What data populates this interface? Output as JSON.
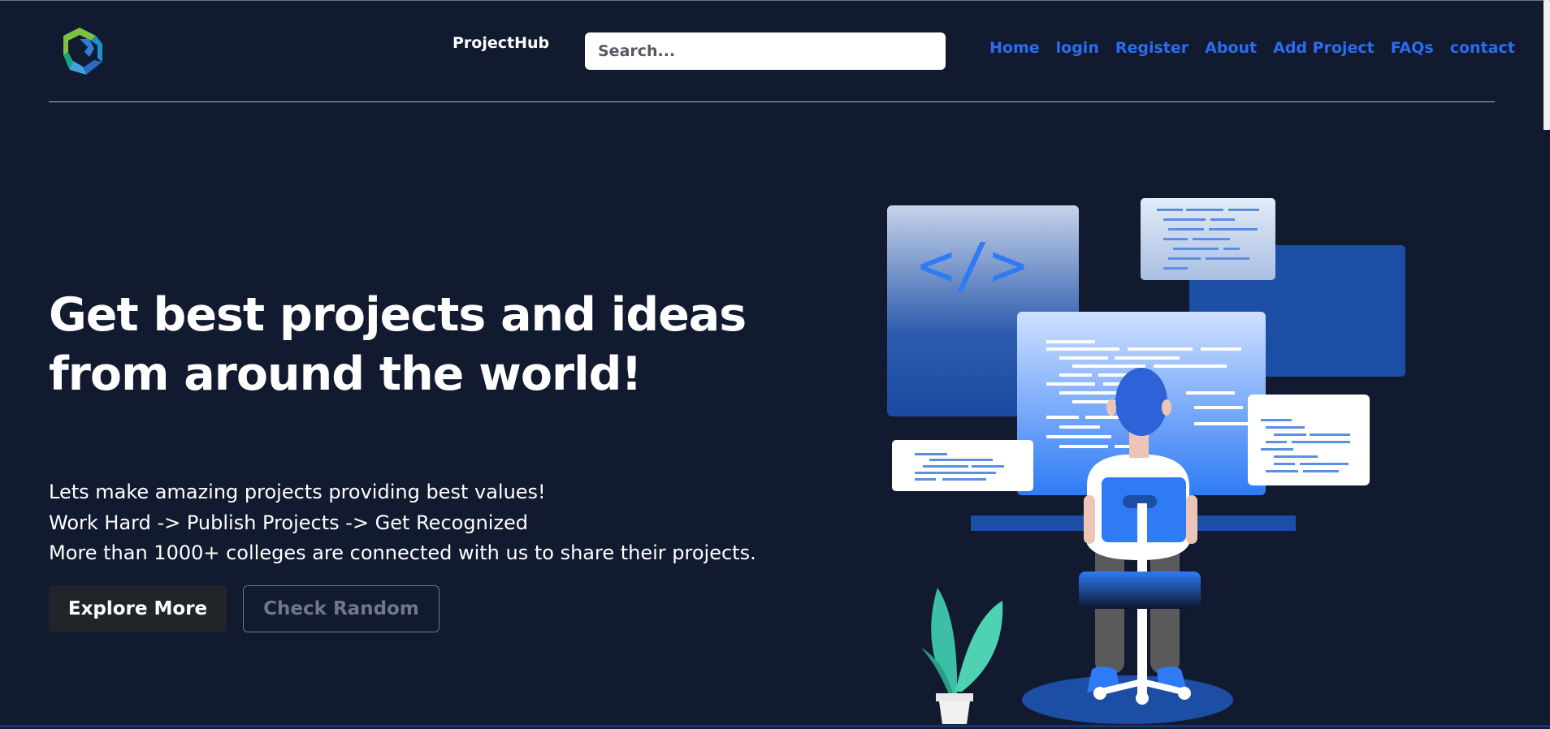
{
  "header": {
    "brand": "ProjectHub",
    "search_placeholder": "Search...",
    "nav": [
      "Home",
      "login",
      "Register",
      "About",
      "Add Project",
      "FAQs",
      "contact"
    ]
  },
  "hero": {
    "headline_line1": "Get best projects and ideas",
    "headline_line2": "from around the world!",
    "taglines": [
      "Lets make amazing projects providing best values!",
      "Work Hard -> Publish Projects -> Get Recognized",
      "More than 1000+ colleges are connected with us to share their projects."
    ],
    "primary_button": "Explore More",
    "secondary_button": "Check Random",
    "code_symbol": "</>"
  },
  "colors": {
    "background": "#121a30",
    "nav_link": "#2a6df0",
    "accent_blue": "#2f7bf5"
  }
}
